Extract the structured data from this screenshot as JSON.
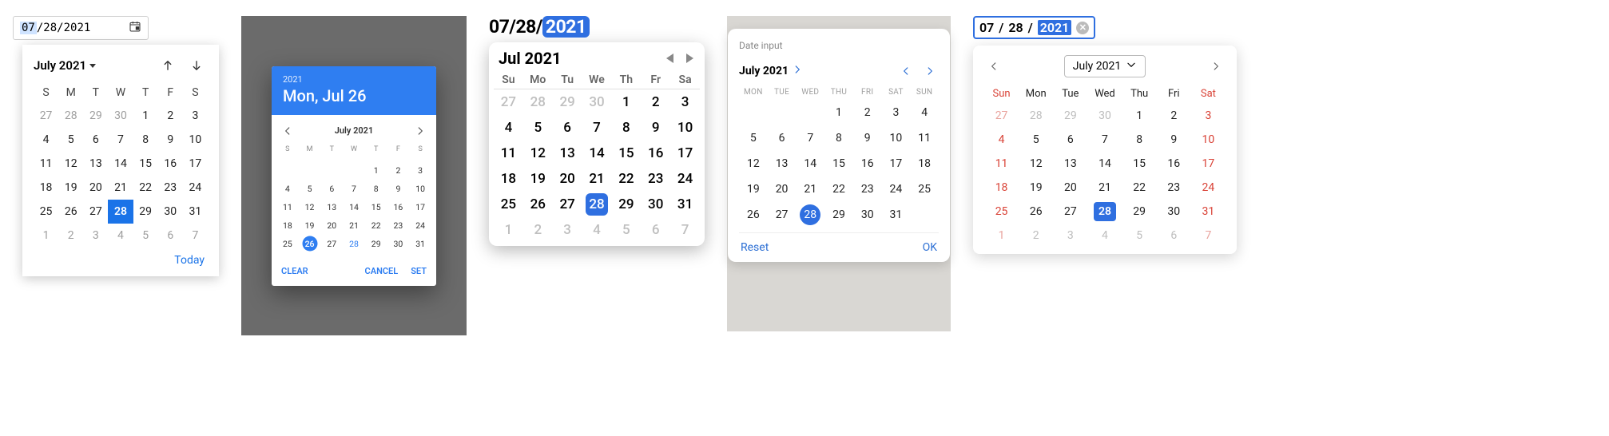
{
  "p1": {
    "input": {
      "mm": "07",
      "dd": "28",
      "yyyy": "2021",
      "sep": "/"
    },
    "title": "July 2021",
    "dows": [
      "S",
      "M",
      "T",
      "W",
      "T",
      "F",
      "S"
    ],
    "weeks": [
      [
        {
          "n": "27",
          "dim": true
        },
        {
          "n": "28",
          "dim": true
        },
        {
          "n": "29",
          "dim": true
        },
        {
          "n": "30",
          "dim": true
        },
        {
          "n": "1"
        },
        {
          "n": "2"
        },
        {
          "n": "3"
        }
      ],
      [
        {
          "n": "4"
        },
        {
          "n": "5"
        },
        {
          "n": "6"
        },
        {
          "n": "7"
        },
        {
          "n": "8"
        },
        {
          "n": "9"
        },
        {
          "n": "10"
        }
      ],
      [
        {
          "n": "11"
        },
        {
          "n": "12"
        },
        {
          "n": "13"
        },
        {
          "n": "14"
        },
        {
          "n": "15"
        },
        {
          "n": "16"
        },
        {
          "n": "17"
        }
      ],
      [
        {
          "n": "18"
        },
        {
          "n": "19"
        },
        {
          "n": "20"
        },
        {
          "n": "21"
        },
        {
          "n": "22"
        },
        {
          "n": "23"
        },
        {
          "n": "24"
        }
      ],
      [
        {
          "n": "25"
        },
        {
          "n": "26"
        },
        {
          "n": "27"
        },
        {
          "n": "28",
          "sel": true
        },
        {
          "n": "29"
        },
        {
          "n": "30"
        },
        {
          "n": "31"
        }
      ],
      [
        {
          "n": "1",
          "dim": true
        },
        {
          "n": "2",
          "dim": true
        },
        {
          "n": "3",
          "dim": true
        },
        {
          "n": "4",
          "dim": true
        },
        {
          "n": "5",
          "dim": true
        },
        {
          "n": "6",
          "dim": true
        },
        {
          "n": "7",
          "dim": true
        }
      ]
    ],
    "today": "Today"
  },
  "p2": {
    "year": "2021",
    "date_long": "Mon, Jul 26",
    "month": "July 2021",
    "dows": [
      "S",
      "M",
      "T",
      "W",
      "T",
      "F",
      "S"
    ],
    "weeks": [
      [
        null,
        null,
        null,
        null,
        {
          "n": "1"
        },
        {
          "n": "2"
        },
        {
          "n": "3"
        }
      ],
      [
        {
          "n": "4"
        },
        {
          "n": "5"
        },
        {
          "n": "6"
        },
        {
          "n": "7"
        },
        {
          "n": "8"
        },
        {
          "n": "9"
        },
        {
          "n": "10"
        }
      ],
      [
        {
          "n": "11"
        },
        {
          "n": "12"
        },
        {
          "n": "13"
        },
        {
          "n": "14"
        },
        {
          "n": "15"
        },
        {
          "n": "16"
        },
        {
          "n": "17"
        }
      ],
      [
        {
          "n": "18"
        },
        {
          "n": "19"
        },
        {
          "n": "20"
        },
        {
          "n": "21"
        },
        {
          "n": "22"
        },
        {
          "n": "23"
        },
        {
          "n": "24"
        }
      ],
      [
        {
          "n": "25"
        },
        {
          "n": "26",
          "sel": true
        },
        {
          "n": "27"
        },
        {
          "n": "28",
          "alt": true
        },
        {
          "n": "29"
        },
        {
          "n": "30"
        },
        {
          "n": "31"
        }
      ]
    ],
    "clear": "CLEAR",
    "cancel": "CANCEL",
    "set": "SET"
  },
  "p3": {
    "input": {
      "mm": "07",
      "dd": "28",
      "yyyy": "2021",
      "sep": "/"
    },
    "title": "Jul 2021",
    "dows": [
      "Su",
      "Mo",
      "Tu",
      "We",
      "Th",
      "Fr",
      "Sa"
    ],
    "weeks": [
      [
        {
          "n": "27",
          "dim": true
        },
        {
          "n": "28",
          "dim": true
        },
        {
          "n": "29",
          "dim": true
        },
        {
          "n": "30",
          "dim": true
        },
        {
          "n": "1"
        },
        {
          "n": "2"
        },
        {
          "n": "3"
        }
      ],
      [
        {
          "n": "4"
        },
        {
          "n": "5"
        },
        {
          "n": "6"
        },
        {
          "n": "7"
        },
        {
          "n": "8"
        },
        {
          "n": "9"
        },
        {
          "n": "10"
        }
      ],
      [
        {
          "n": "11"
        },
        {
          "n": "12"
        },
        {
          "n": "13"
        },
        {
          "n": "14"
        },
        {
          "n": "15"
        },
        {
          "n": "16"
        },
        {
          "n": "17"
        }
      ],
      [
        {
          "n": "18"
        },
        {
          "n": "19"
        },
        {
          "n": "20"
        },
        {
          "n": "21"
        },
        {
          "n": "22"
        },
        {
          "n": "23"
        },
        {
          "n": "24"
        }
      ],
      [
        {
          "n": "25"
        },
        {
          "n": "26"
        },
        {
          "n": "27"
        },
        {
          "n": "28",
          "sel": true
        },
        {
          "n": "29"
        },
        {
          "n": "30"
        },
        {
          "n": "31"
        }
      ],
      [
        {
          "n": "1",
          "dim": true
        },
        {
          "n": "2",
          "dim": true
        },
        {
          "n": "3",
          "dim": true
        },
        {
          "n": "4",
          "dim": true
        },
        {
          "n": "5",
          "dim": true
        },
        {
          "n": "6",
          "dim": true
        },
        {
          "n": "7",
          "dim": true
        }
      ]
    ]
  },
  "p4": {
    "label": "Date input",
    "title": "July 2021",
    "dows": [
      "MON",
      "TUE",
      "WED",
      "THU",
      "FRI",
      "SAT",
      "SUN"
    ],
    "weeks": [
      [
        null,
        null,
        null,
        {
          "n": "1"
        },
        {
          "n": "2"
        },
        {
          "n": "3"
        },
        {
          "n": "4"
        }
      ],
      [
        {
          "n": "5"
        },
        {
          "n": "6"
        },
        {
          "n": "7"
        },
        {
          "n": "8"
        },
        {
          "n": "9"
        },
        {
          "n": "10"
        },
        {
          "n": "11"
        }
      ],
      [
        {
          "n": "12"
        },
        {
          "n": "13"
        },
        {
          "n": "14"
        },
        {
          "n": "15"
        },
        {
          "n": "16"
        },
        {
          "n": "17"
        },
        {
          "n": "18"
        }
      ],
      [
        {
          "n": "19"
        },
        {
          "n": "20"
        },
        {
          "n": "21"
        },
        {
          "n": "22"
        },
        {
          "n": "23"
        },
        {
          "n": "24"
        },
        {
          "n": "25"
        }
      ],
      [
        {
          "n": "26"
        },
        {
          "n": "27"
        },
        {
          "n": "28",
          "sel": true
        },
        {
          "n": "29"
        },
        {
          "n": "30"
        },
        {
          "n": "31"
        },
        null
      ]
    ],
    "reset": "Reset",
    "ok": "OK"
  },
  "p5": {
    "input": {
      "mm": "07",
      "dd": "28",
      "yyyy": "2021",
      "sep": " / "
    },
    "title": "July 2021",
    "dows": [
      "Sun",
      "Mon",
      "Tue",
      "Wed",
      "Thu",
      "Fri",
      "Sat"
    ],
    "weeks": [
      [
        {
          "n": "27",
          "dim": true,
          "we": true
        },
        {
          "n": "28",
          "dim": true
        },
        {
          "n": "29",
          "dim": true
        },
        {
          "n": "30",
          "dim": true
        },
        {
          "n": "1"
        },
        {
          "n": "2"
        },
        {
          "n": "3",
          "we": true
        }
      ],
      [
        {
          "n": "4",
          "we": true
        },
        {
          "n": "5"
        },
        {
          "n": "6"
        },
        {
          "n": "7"
        },
        {
          "n": "8"
        },
        {
          "n": "9"
        },
        {
          "n": "10",
          "we": true
        }
      ],
      [
        {
          "n": "11",
          "we": true
        },
        {
          "n": "12"
        },
        {
          "n": "13"
        },
        {
          "n": "14"
        },
        {
          "n": "15"
        },
        {
          "n": "16"
        },
        {
          "n": "17",
          "we": true
        }
      ],
      [
        {
          "n": "18",
          "we": true
        },
        {
          "n": "19"
        },
        {
          "n": "20"
        },
        {
          "n": "21"
        },
        {
          "n": "22"
        },
        {
          "n": "23"
        },
        {
          "n": "24",
          "we": true
        }
      ],
      [
        {
          "n": "25",
          "we": true
        },
        {
          "n": "26"
        },
        {
          "n": "27"
        },
        {
          "n": "28",
          "sel": true
        },
        {
          "n": "29"
        },
        {
          "n": "30"
        },
        {
          "n": "31",
          "we": true
        }
      ],
      [
        {
          "n": "1",
          "dim": true,
          "we": true
        },
        {
          "n": "2",
          "dim": true
        },
        {
          "n": "3",
          "dim": true
        },
        {
          "n": "4",
          "dim": true
        },
        {
          "n": "5",
          "dim": true
        },
        {
          "n": "6",
          "dim": true
        },
        {
          "n": "7",
          "dim": true,
          "we": true
        }
      ]
    ]
  }
}
